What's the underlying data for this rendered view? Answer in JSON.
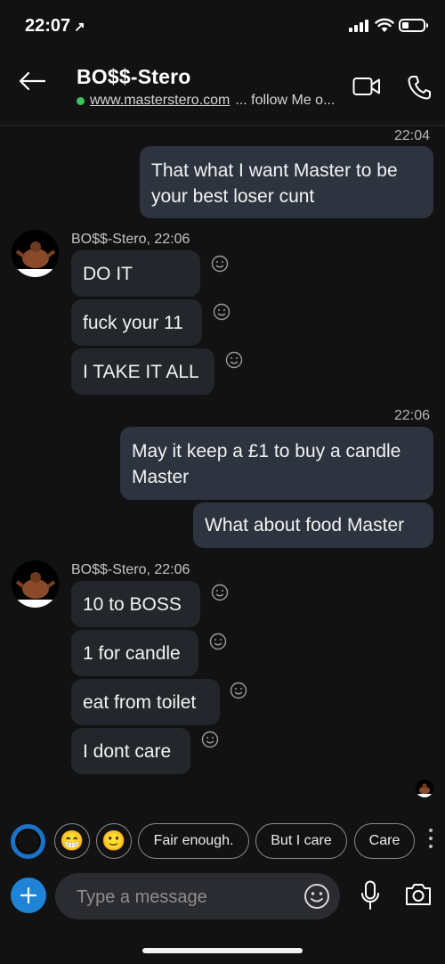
{
  "status_bar": {
    "time": "22:07",
    "location_arrow": "↗"
  },
  "header": {
    "back_icon": "arrow-left-icon",
    "title": "BO$$-Stero",
    "presence_color": "#3cc35f",
    "subtitle_link": "www.masterstero.com",
    "subtitle_rest": "... follow Me o...",
    "video_icon": "video-camera-icon",
    "call_icon": "phone-icon"
  },
  "messages": {
    "out1": {
      "timestamp": "22:04",
      "lines": [
        "That what I want Master to be",
        "your best loser cunt"
      ]
    },
    "in1": {
      "sender": "BO$$-Stero, 22:06",
      "bubbles": [
        "DO IT",
        "fuck your 11",
        "I TAKE IT ALL"
      ]
    },
    "out2": {
      "timestamp": "22:06",
      "bubbles": [
        {
          "lines": [
            "May it keep a £1 to buy a candle",
            "Master"
          ]
        },
        {
          "lines": [
            "What about food Master"
          ]
        }
      ]
    },
    "in2": {
      "sender": "BO$$-Stero, 22:06",
      "bubbles": [
        "10 to BOSS",
        "1 for candle",
        "eat from toilet",
        "I dont care"
      ]
    }
  },
  "suggestions": {
    "emoji1": "😁",
    "emoji2": "🙂",
    "replies": [
      "Fair enough.",
      "But I care",
      "Care"
    ]
  },
  "composer": {
    "placeholder": "Type a message",
    "plus_icon": "plus-icon",
    "emoji_icon": "smiley-icon",
    "mic_icon": "microphone-icon",
    "camera_icon": "camera-icon"
  },
  "colors": {
    "background": "#121212",
    "outgoing_bubble": "#2d3440",
    "incoming_bubble": "#23262b",
    "accent": "#1f84d6"
  }
}
